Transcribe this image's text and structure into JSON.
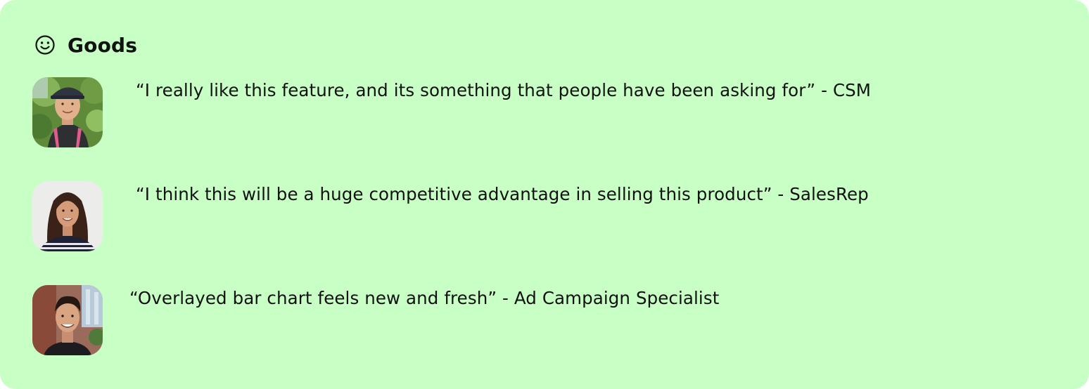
{
  "section": {
    "icon": "smile-icon",
    "title": "Goods",
    "background_color": "#c8ffc4"
  },
  "feedback": [
    {
      "avatar": "avatar-photo",
      "quote": "“I really like this feature, and its something that people have been asking for” - CSM"
    },
    {
      "avatar": "avatar-photo",
      "quote": "“I think this will be a huge competitive advantage in selling this product” - SalesRep"
    },
    {
      "avatar": "avatar-photo",
      "quote": "“Overlayed bar chart feels new and fresh” - Ad Campaign Specialist"
    }
  ]
}
